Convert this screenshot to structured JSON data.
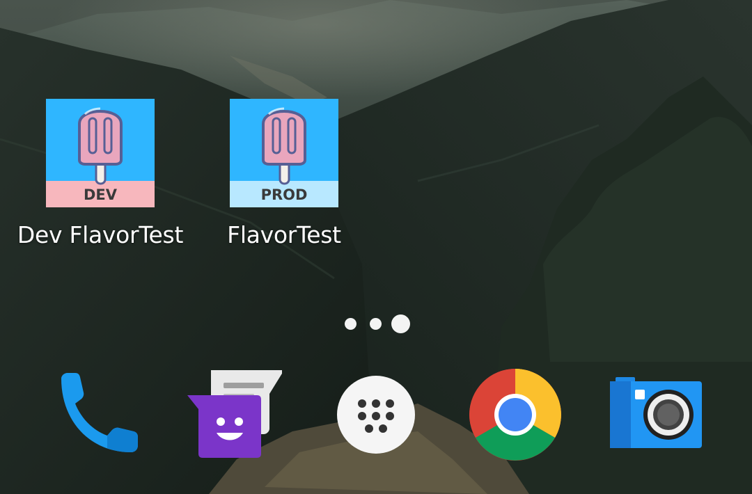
{
  "home": {
    "apps": [
      {
        "label": "Dev FlavorTest",
        "banner": "DEV",
        "banner_color": "#f7b7bd"
      },
      {
        "label": "FlavorTest",
        "banner": "PROD",
        "banner_color": "#b8e8ff"
      }
    ],
    "icon_background": "#2fb6ff",
    "popsicle_color": "#e9a6bd",
    "popsicle_outline": "#565f95"
  },
  "pager": {
    "pages": 3,
    "current_page": 3
  },
  "dock": {
    "items": [
      {
        "icon": "phone-icon"
      },
      {
        "icon": "messages-icon"
      },
      {
        "icon": "app-drawer-icon"
      },
      {
        "icon": "chrome-icon"
      },
      {
        "icon": "camera-icon"
      }
    ]
  }
}
